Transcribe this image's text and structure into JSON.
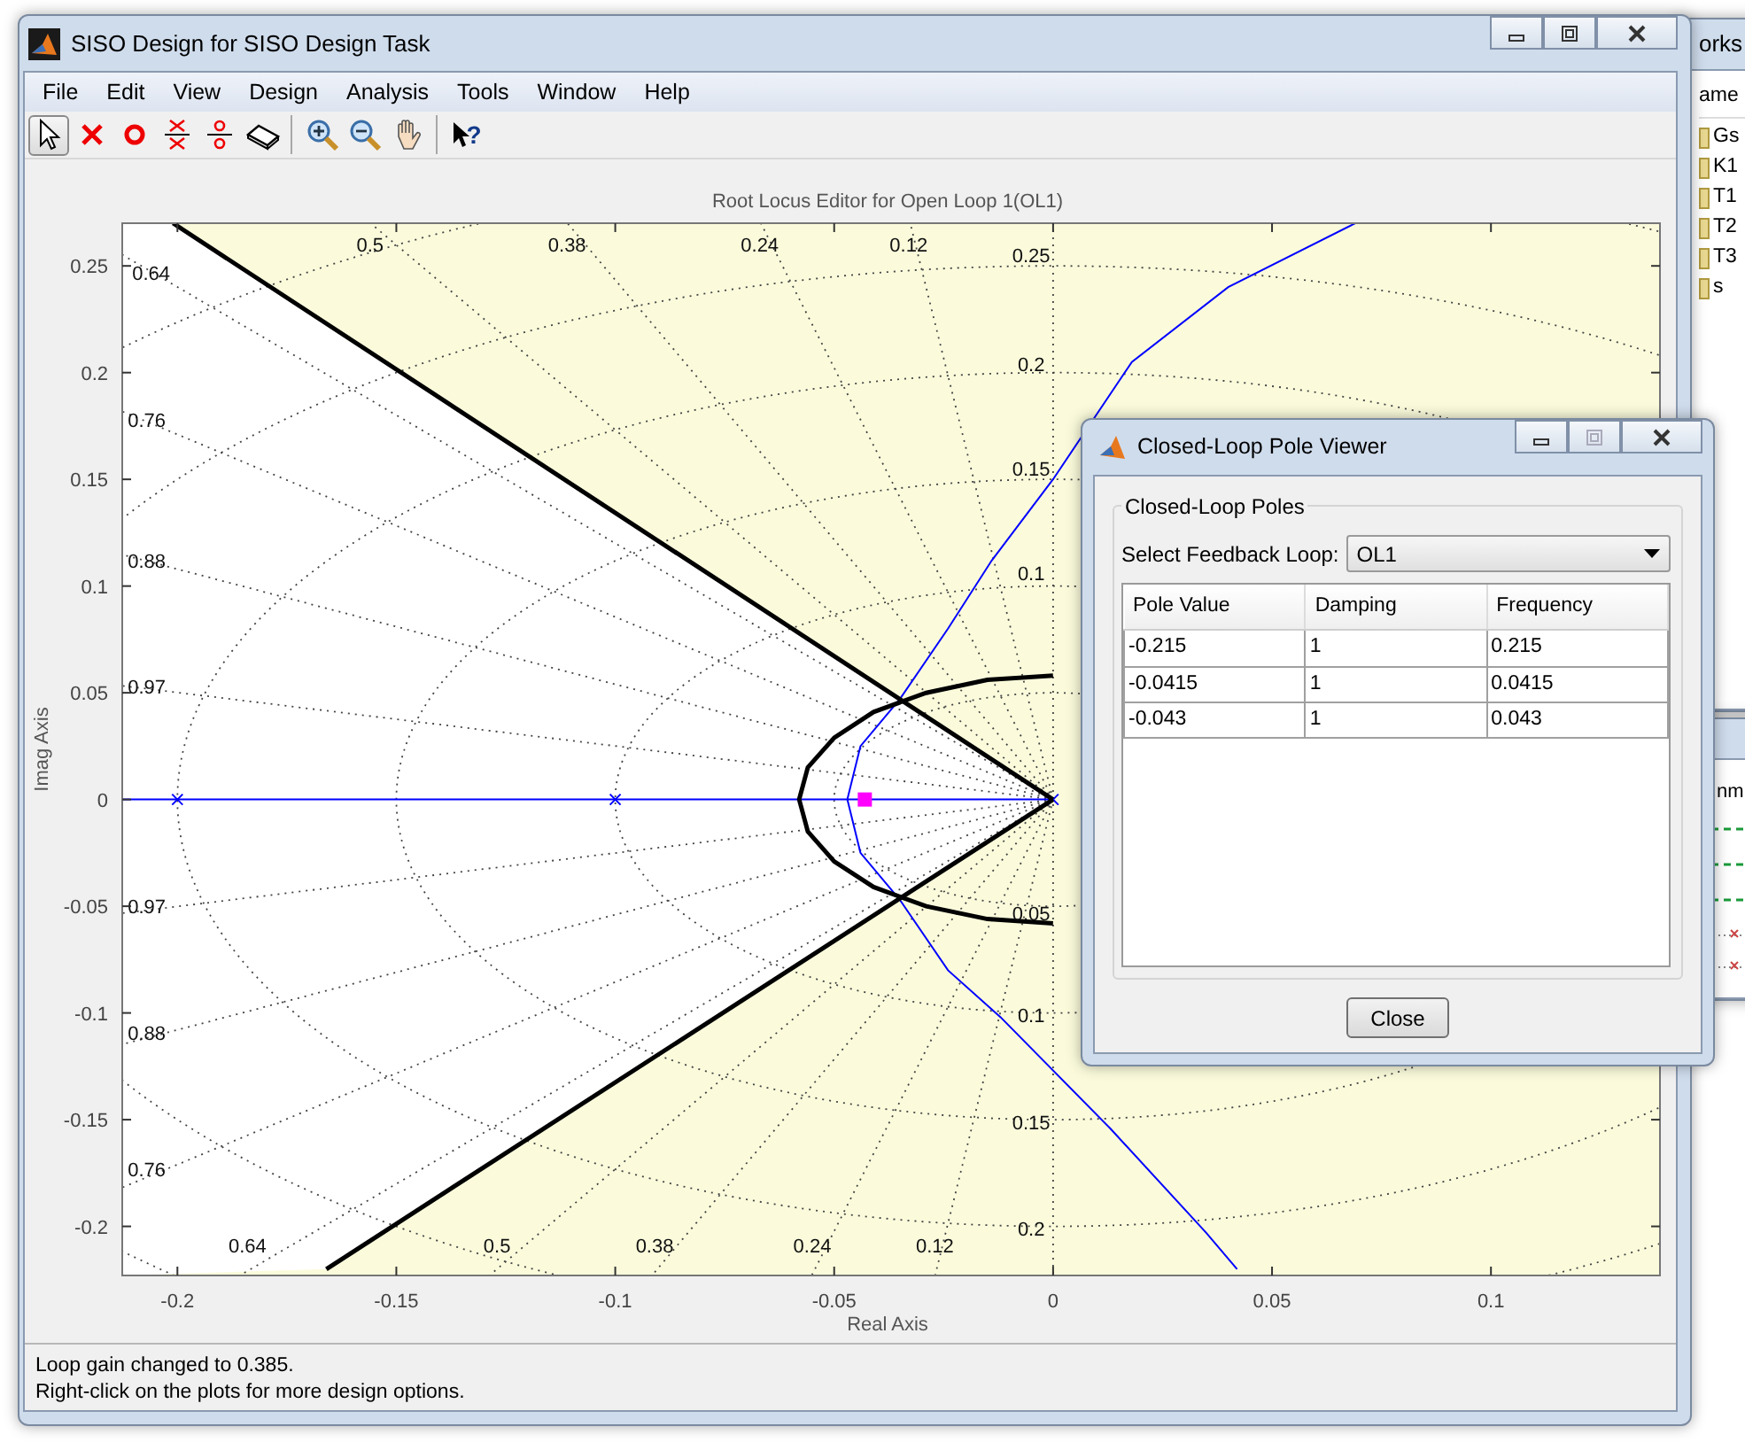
{
  "main_window": {
    "title": "SISO Design for SISO Design Task"
  },
  "menu": [
    "File",
    "Edit",
    "View",
    "Design",
    "Analysis",
    "Tools",
    "Window",
    "Help"
  ],
  "toolbar": [
    [
      {
        "kind": "select",
        "selected": true
      },
      {
        "kind": "pole",
        "selected": false
      },
      {
        "kind": "zero",
        "selected": false
      },
      {
        "kind": "pole_pair",
        "selected": false
      },
      {
        "kind": "zero_pair",
        "selected": false
      },
      {
        "kind": "eraser",
        "selected": false
      }
    ],
    [
      {
        "kind": "zoom_in",
        "selected": false
      },
      {
        "kind": "zoom_out",
        "selected": false
      },
      {
        "kind": "pan",
        "selected": false
      }
    ],
    [
      {
        "kind": "whats_this",
        "selected": false,
        "glyph": "?"
      }
    ]
  ],
  "plot": {
    "chart_data": {
      "type": "line",
      "title": "Root Locus Editor for Open Loop 1(OL1)",
      "xlabel": "Real Axis",
      "ylabel": "Imag Axis",
      "xlim": [
        -0.2126,
        0.1386
      ],
      "ylim": [
        -0.223,
        0.27
      ],
      "xticks": [
        -0.2,
        -0.15,
        -0.1,
        -0.05,
        0,
        0.05,
        0.1
      ],
      "yticks": [
        -0.2,
        -0.15,
        -0.1,
        -0.05,
        0,
        0.05,
        0.1,
        0.15,
        0.2,
        0.25
      ],
      "series": [
        {
          "color": "#0000ff",
          "x": [
            -0.2126,
            -0.2
          ],
          "values": [
            0,
            0
          ]
        },
        {
          "color": "#0000ff",
          "x": [
            -0.2,
            -0.1,
            0
          ],
          "values": [
            0,
            0,
            0
          ],
          "marker": "x"
        },
        {
          "color": "#0000ff",
          "x": [
            -0.047,
            -0.044,
            -0.035,
            -0.024,
            -0.014,
            0,
            0.018,
            0.04,
            0.069
          ],
          "values": [
            0,
            0.025,
            0.047,
            0.08,
            0.112,
            0.15,
            0.205,
            0.24,
            0.27
          ]
        },
        {
          "color": "#0000ff",
          "x": [
            -0.047,
            -0.044,
            -0.035,
            -0.024,
            -0.012,
            0.013,
            0.035,
            0.042
          ],
          "values": [
            0,
            -0.025,
            -0.047,
            -0.08,
            -0.102,
            -0.154,
            -0.203,
            -0.22
          ]
        },
        {
          "color": "#000000",
          "x": [
            0,
            -0.201
          ],
          "values": [
            0,
            0.27
          ]
        },
        {
          "color": "#000000",
          "x": [
            0,
            -0.166
          ],
          "values": [
            0,
            -0.22
          ]
        },
        {
          "color": "#000000",
          "x": [
            0,
            -0.015,
            -0.029,
            -0.041,
            -0.05,
            -0.056,
            -0.058,
            -0.056,
            -0.05,
            -0.041,
            -0.029,
            -0.015,
            0
          ],
          "values": [
            0.058,
            0.056,
            0.05,
            0.041,
            0.029,
            0.015,
            0,
            -0.015,
            -0.029,
            -0.041,
            -0.05,
            -0.056,
            -0.058
          ]
        },
        {
          "color": "#ff00ff",
          "x": [
            -0.043
          ],
          "values": [
            0
          ],
          "marker": "square"
        }
      ],
      "annotations": [
        "0.64",
        "0.5",
        "0.38",
        "0.24",
        "0.12",
        "0.25",
        "0.2",
        "0.15",
        "0.1",
        "0.76",
        "0.88",
        "0.97",
        "0.97",
        "0.88",
        "0.76",
        "0.05",
        "0.1",
        "0.15",
        "0.2",
        "0.64",
        "0.5",
        "0.38",
        "0.24",
        "0.12"
      ]
    }
  },
  "status_bar": [
    "Loop gain changed to 0.385.",
    "Right-click on the plots for more design options."
  ],
  "pole_viewer": {
    "title": "Closed-Loop Pole Viewer",
    "group_title": "Closed-Loop Poles",
    "loop_label": "Select Feedback Loop:",
    "loop_value": "OL1",
    "columns": [
      "Pole Value",
      "Damping",
      "Frequency"
    ],
    "rows": [
      [
        "-0.215",
        "1",
        "0.215"
      ],
      [
        "-0.0415",
        "1",
        "0.0415"
      ],
      [
        "-0.043",
        "1",
        "0.043"
      ]
    ],
    "close_button": "Close"
  },
  "workspace": {
    "title": "orks",
    "column": "ame",
    "variables": [
      "Gs",
      "K1",
      "T1",
      "T2",
      "T3",
      "s"
    ],
    "lower_header": "nm"
  }
}
